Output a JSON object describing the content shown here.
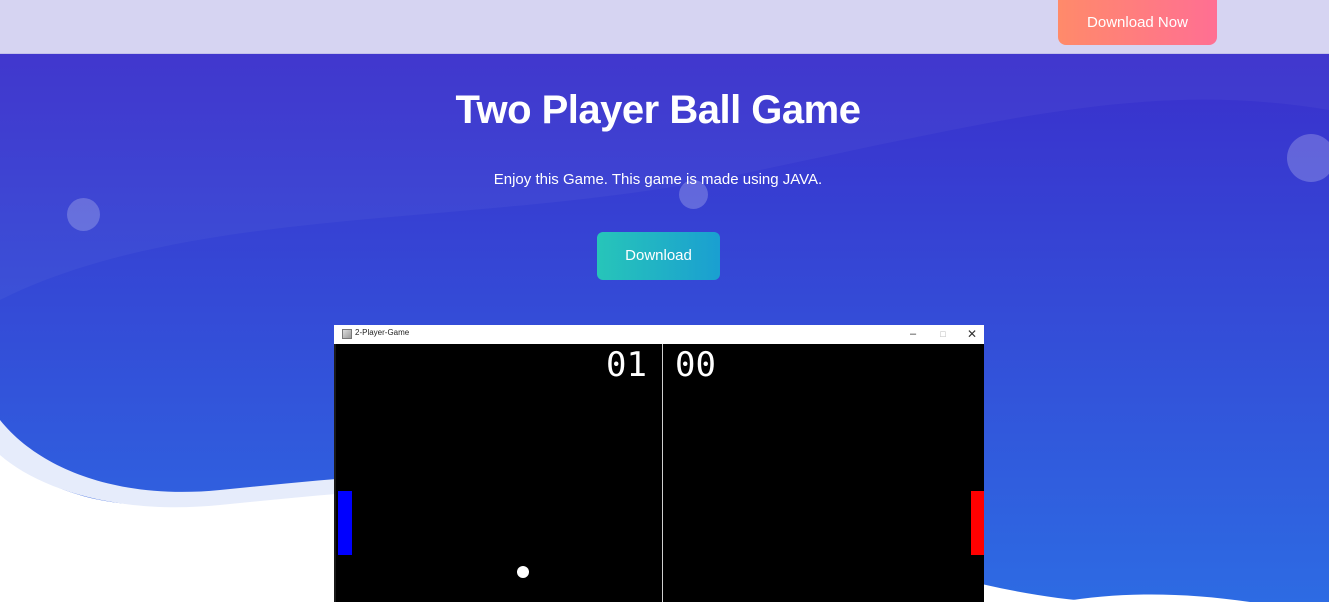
{
  "header": {
    "cta_label": "Download Now"
  },
  "hero": {
    "title": "Two Player Ball Game",
    "subtitle": "Enjoy this Game. This game is made using JAVA.",
    "cta_label": "Download"
  },
  "game_window": {
    "title": "2-Player-Game",
    "minimize_glyph": "–",
    "maximize_glyph": "□",
    "close_glyph": "✕",
    "score_left": "01",
    "score_right": "00",
    "left_paddle_color": "#0000ff",
    "right_paddle_color": "#ff0000"
  },
  "colors": {
    "header_bg": "#d6d4f2",
    "hero_top": "#3a2fcc",
    "hero_bottom": "#2d6be3",
    "cta_top_start": "#ff8a6a",
    "cta_top_end": "#ff6f93",
    "cta_main_start": "#27c5b9",
    "cta_main_end": "#1a9fd1"
  }
}
